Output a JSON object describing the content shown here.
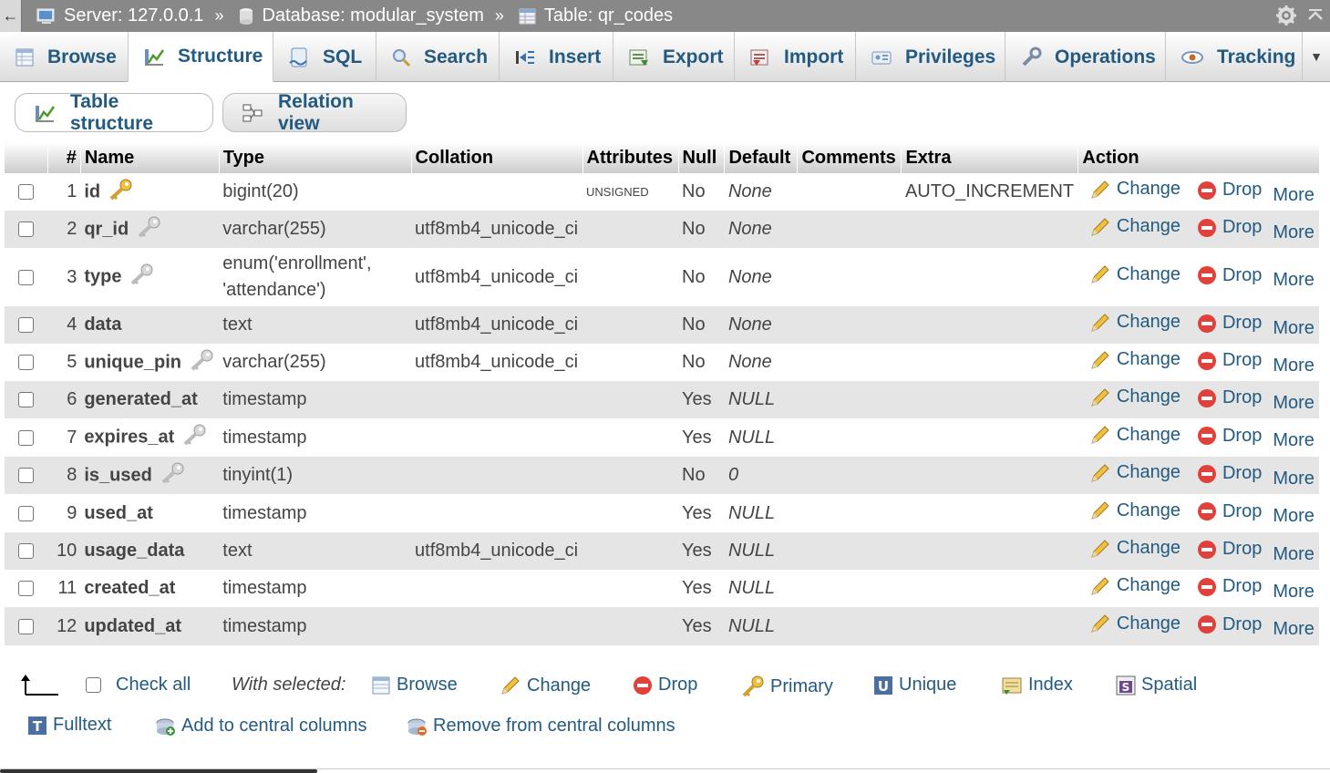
{
  "breadcrumb": {
    "back_label": "←",
    "server": "Server: 127.0.0.1",
    "sep1": "»",
    "database": "Database: modular_system",
    "sep2": "»",
    "table": "Table: qr_codes"
  },
  "tabs": [
    {
      "label": "Browse",
      "icon": "browse-icon"
    },
    {
      "label": "Structure",
      "icon": "structure-icon",
      "active": true
    },
    {
      "label": "SQL",
      "icon": "sql-icon"
    },
    {
      "label": "Search",
      "icon": "search-icon"
    },
    {
      "label": "Insert",
      "icon": "insert-icon"
    },
    {
      "label": "Export",
      "icon": "export-icon"
    },
    {
      "label": "Import",
      "icon": "import-icon"
    },
    {
      "label": "Privileges",
      "icon": "privileges-icon"
    },
    {
      "label": "Operations",
      "icon": "operations-icon"
    },
    {
      "label": "Tracking",
      "icon": "tracking-icon"
    }
  ],
  "subtabs": {
    "table_structure": "Table structure",
    "relation_view": "Relation view"
  },
  "table": {
    "headers": {
      "num": "#",
      "name": "Name",
      "type": "Type",
      "collation": "Collation",
      "attributes": "Attributes",
      "null": "Null",
      "default": "Default",
      "comments": "Comments",
      "extra": "Extra",
      "action": "Action"
    },
    "rows": [
      {
        "num": "1",
        "name": "id",
        "key": "primary",
        "type": "bigint(20)",
        "type2": "",
        "collation": "",
        "attributes": "UNSIGNED",
        "null": "No",
        "default": "None",
        "extra": "AUTO_INCREMENT"
      },
      {
        "num": "2",
        "name": "qr_id",
        "key": "index",
        "type": "varchar(255)",
        "type2": "",
        "collation": "utf8mb4_unicode_ci",
        "attributes": "",
        "null": "No",
        "default": "None",
        "extra": ""
      },
      {
        "num": "3",
        "name": "type",
        "key": "index",
        "type": "enum('enrollment',",
        "type2": "'attendance')",
        "collation": "utf8mb4_unicode_ci",
        "attributes": "",
        "null": "No",
        "default": "None",
        "extra": ""
      },
      {
        "num": "4",
        "name": "data",
        "key": "",
        "type": "text",
        "type2": "",
        "collation": "utf8mb4_unicode_ci",
        "attributes": "",
        "null": "No",
        "default": "None",
        "extra": ""
      },
      {
        "num": "5",
        "name": "unique_pin",
        "key": "index",
        "type": "varchar(255)",
        "type2": "",
        "collation": "utf8mb4_unicode_ci",
        "attributes": "",
        "null": "No",
        "default": "None",
        "extra": ""
      },
      {
        "num": "6",
        "name": "generated_at",
        "key": "",
        "type": "timestamp",
        "type2": "",
        "collation": "",
        "attributes": "",
        "null": "Yes",
        "default": "NULL",
        "extra": ""
      },
      {
        "num": "7",
        "name": "expires_at",
        "key": "index",
        "type": "timestamp",
        "type2": "",
        "collation": "",
        "attributes": "",
        "null": "Yes",
        "default": "NULL",
        "extra": ""
      },
      {
        "num": "8",
        "name": "is_used",
        "key": "index",
        "type": "tinyint(1)",
        "type2": "",
        "collation": "",
        "attributes": "",
        "null": "No",
        "default": "0",
        "extra": ""
      },
      {
        "num": "9",
        "name": "used_at",
        "key": "",
        "type": "timestamp",
        "type2": "",
        "collation": "",
        "attributes": "",
        "null": "Yes",
        "default": "NULL",
        "extra": ""
      },
      {
        "num": "10",
        "name": "usage_data",
        "key": "",
        "type": "text",
        "type2": "",
        "collation": "utf8mb4_unicode_ci",
        "attributes": "",
        "null": "Yes",
        "default": "NULL",
        "extra": ""
      },
      {
        "num": "11",
        "name": "created_at",
        "key": "",
        "type": "timestamp",
        "type2": "",
        "collation": "",
        "attributes": "",
        "null": "Yes",
        "default": "NULL",
        "extra": ""
      },
      {
        "num": "12",
        "name": "updated_at",
        "key": "",
        "type": "timestamp",
        "type2": "",
        "collation": "",
        "attributes": "",
        "null": "Yes",
        "default": "NULL",
        "extra": ""
      }
    ],
    "actions": {
      "change": "Change",
      "drop": "Drop",
      "more": "More"
    }
  },
  "bulk": {
    "check_all": "Check all",
    "with_selected": "With selected:",
    "browse": "Browse",
    "change": "Change",
    "drop": "Drop",
    "primary": "Primary",
    "unique": "Unique",
    "index": "Index",
    "spatial": "Spatial",
    "fulltext": "Fulltext",
    "add_central": "Add to central columns",
    "remove_central": "Remove from central columns"
  },
  "colors": {
    "link": "#235a81",
    "topbar": "#888888",
    "row_alt": "#e5e5e5",
    "drop_red": "#e0413b",
    "key_gold": "#e8b83a"
  }
}
